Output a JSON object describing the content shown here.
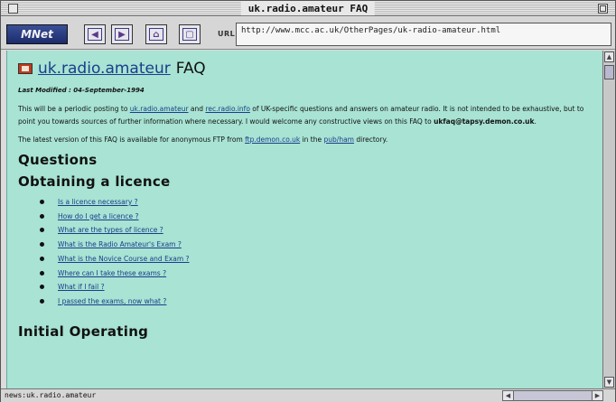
{
  "window": {
    "title": "uk.radio.amateur FAQ"
  },
  "toolbar": {
    "logo": "MNet",
    "url_label": "URL",
    "url_value": "http://www.mcc.ac.uk/OtherPages/uk-radio-amateur.html"
  },
  "status": {
    "message": "news:uk.radio.amateur"
  },
  "page": {
    "heading_link": "uk.radio.amateur",
    "heading_suffix": "FAQ",
    "last_modified": "Last Modified : 04-September-1994",
    "intro": {
      "t1": "This will be a periodic posting to ",
      "link1": "uk.radio.amateur",
      "t2": " and ",
      "link2": "rec.radio.info",
      "t3": " of UK-specific questions and answers on amateur radio. It is not intended to be exhaustive, but to point you towards sources of further information where necessary. I would welcome any constructive views on this FAQ to ",
      "email": "ukfaq@tapsy.demon.co.uk",
      "t4": "."
    },
    "ftp": {
      "t1": "The latest version of this FAQ is available for anonymous FTP from ",
      "link1": "ftp.demon.co.uk",
      "t2": " in the ",
      "link2": "pub/ham",
      "t3": " directory."
    },
    "section_questions": "Questions",
    "section_licence": "Obtaining a licence",
    "questions": [
      "Is a licence necessary ?",
      "How do I get a licence ?",
      "What are the types of licence ?",
      "What is the Radio Amateur's Exam ?",
      "What is the Novice Course and Exam ?",
      "Where can I take these exams ?",
      "What if I fail ?",
      "I passed the exams, now what ?"
    ],
    "section_initial": "Initial Operating"
  }
}
